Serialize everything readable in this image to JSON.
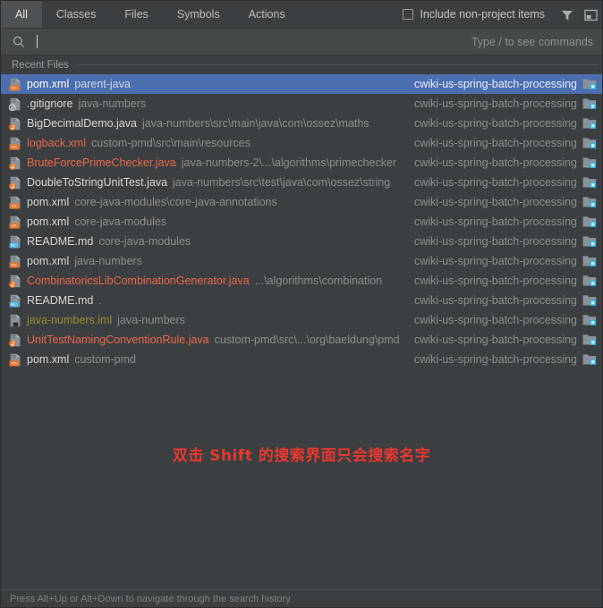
{
  "tabs": [
    {
      "label": "All",
      "active": true
    },
    {
      "label": "Classes",
      "active": false
    },
    {
      "label": "Files",
      "active": false
    },
    {
      "label": "Symbols",
      "active": false
    },
    {
      "label": "Actions",
      "active": false
    }
  ],
  "toolbar": {
    "include_non_project_label": "Include non-project items",
    "include_non_project_checked": false,
    "filter_icon": "filter-funnel-icon",
    "preview_icon": "toggle-preview-panel-icon"
  },
  "search": {
    "icon": "search-icon",
    "value": "",
    "placeholder": "",
    "hint": "Type / to see commands"
  },
  "group": {
    "title": "Recent Files"
  },
  "colors": {
    "background": "#3c3f41",
    "selection": "#4b6eaf",
    "modified_file": "#e8674a",
    "ignored_file": "#9a8b33",
    "note_red": "#e8382f"
  },
  "project_icon": "module-folder-icon",
  "files": [
    {
      "icon": "xml-file-icon",
      "name": "pom.xml",
      "name_color": "normal",
      "path": "parent-java",
      "project": "cwiki-us-spring-batch-processing",
      "selected": true
    },
    {
      "icon": "gitignore-file-icon",
      "name": ".gitignore",
      "name_color": "normal",
      "path": "java-numbers",
      "project": "cwiki-us-spring-batch-processing",
      "selected": false
    },
    {
      "icon": "java-file-icon",
      "name": "BigDecimalDemo.java",
      "name_color": "normal",
      "path": "java-numbers\\src\\main\\java\\com\\ossez\\maths",
      "project": "cwiki-us-spring-batch-processing",
      "selected": false
    },
    {
      "icon": "xml-file-icon",
      "name": "logback.xml",
      "name_color": "red",
      "path": "custom-pmd\\src\\main\\resources",
      "project": "cwiki-us-spring-batch-processing",
      "selected": false
    },
    {
      "icon": "java-file-icon",
      "name": "BruteForcePrimeChecker.java",
      "name_color": "red",
      "path": "java-numbers-2\\...\\algorithms\\primechecker",
      "project": "cwiki-us-spring-batch-processing",
      "selected": false
    },
    {
      "icon": "java-file-icon",
      "name": "DoubleToStringUnitTest.java",
      "name_color": "normal",
      "path": "java-numbers\\src\\test\\java\\com\\ossez\\string",
      "project": "cwiki-us-spring-batch-processing",
      "selected": false
    },
    {
      "icon": "xml-file-icon",
      "name": "pom.xml",
      "name_color": "normal",
      "path": "core-java-modules\\core-java-annotations",
      "project": "cwiki-us-spring-batch-processing",
      "selected": false
    },
    {
      "icon": "xml-file-icon",
      "name": "pom.xml",
      "name_color": "normal",
      "path": "core-java-modules",
      "project": "cwiki-us-spring-batch-processing",
      "selected": false
    },
    {
      "icon": "md-file-icon",
      "name": "README.md",
      "name_color": "normal",
      "path": "core-java-modules",
      "project": "cwiki-us-spring-batch-processing",
      "selected": false
    },
    {
      "icon": "xml-file-icon",
      "name": "pom.xml",
      "name_color": "normal",
      "path": "java-numbers",
      "project": "cwiki-us-spring-batch-processing",
      "selected": false
    },
    {
      "icon": "java-file-icon",
      "name": "CombinatoricsLibCombinationGenerator.java",
      "name_color": "red",
      "path": "...\\algorithms\\combination",
      "project": "cwiki-us-spring-batch-processing",
      "selected": false
    },
    {
      "icon": "md-file-icon",
      "name": "README.md",
      "name_color": "normal",
      "path": ".",
      "project": "cwiki-us-spring-batch-processing",
      "selected": false
    },
    {
      "icon": "iml-file-icon",
      "name": "java-numbers.iml",
      "name_color": "olive",
      "path": "java-numbers",
      "project": "cwiki-us-spring-batch-processing",
      "selected": false
    },
    {
      "icon": "java-file-icon",
      "name": "UnitTestNamingConventionRule.java",
      "name_color": "red",
      "path": "custom-pmd\\src\\...\\org\\baeldung\\pmd",
      "project": "cwiki-us-spring-batch-processing",
      "selected": false
    },
    {
      "icon": "xml-file-icon",
      "name": "pom.xml",
      "name_color": "normal",
      "path": "custom-pmd",
      "project": "cwiki-us-spring-batch-processing",
      "selected": false
    }
  ],
  "note": {
    "text": "双击 Shift 的搜索界面只会搜索名字"
  },
  "statusbar": {
    "text": "Press Alt+Up or Alt+Down to navigate through the search history"
  }
}
